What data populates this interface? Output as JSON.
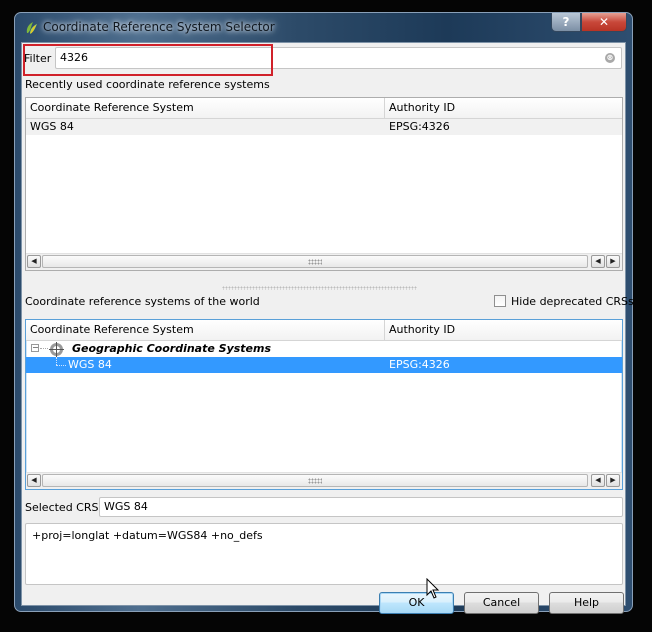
{
  "window": {
    "title": "Coordinate Reference System Selector",
    "help_button": "?",
    "close_button": "✕"
  },
  "filter": {
    "label": "Filter",
    "value": "4326",
    "clear_icon": "⊗"
  },
  "recent": {
    "heading": "Recently used coordinate reference systems",
    "columns": [
      "Coordinate Reference System",
      "Authority ID"
    ],
    "rows": [
      {
        "crs": "WGS 84",
        "authority_id": "EPSG:4326"
      }
    ]
  },
  "world": {
    "heading": "Coordinate reference systems of the world",
    "hide_deprecated_label": "Hide deprecated CRSs",
    "hide_deprecated_checked": false,
    "columns": [
      "Coordinate Reference System",
      "Authority ID"
    ],
    "tree": [
      {
        "group": "Geographic Coordinate Systems",
        "expanded": true,
        "children": [
          {
            "crs": "WGS 84",
            "authority_id": "EPSG:4326",
            "selected": true
          }
        ]
      }
    ]
  },
  "selected_crs": {
    "label": "Selected CRS:",
    "value": "WGS 84"
  },
  "proj_definition": "+proj=longlat +datum=WGS84 +no_defs",
  "buttons": {
    "ok": "OK",
    "cancel": "Cancel",
    "help": "Help"
  },
  "colors": {
    "selection": "#3399ff",
    "highlight_box": "#d0212a"
  }
}
